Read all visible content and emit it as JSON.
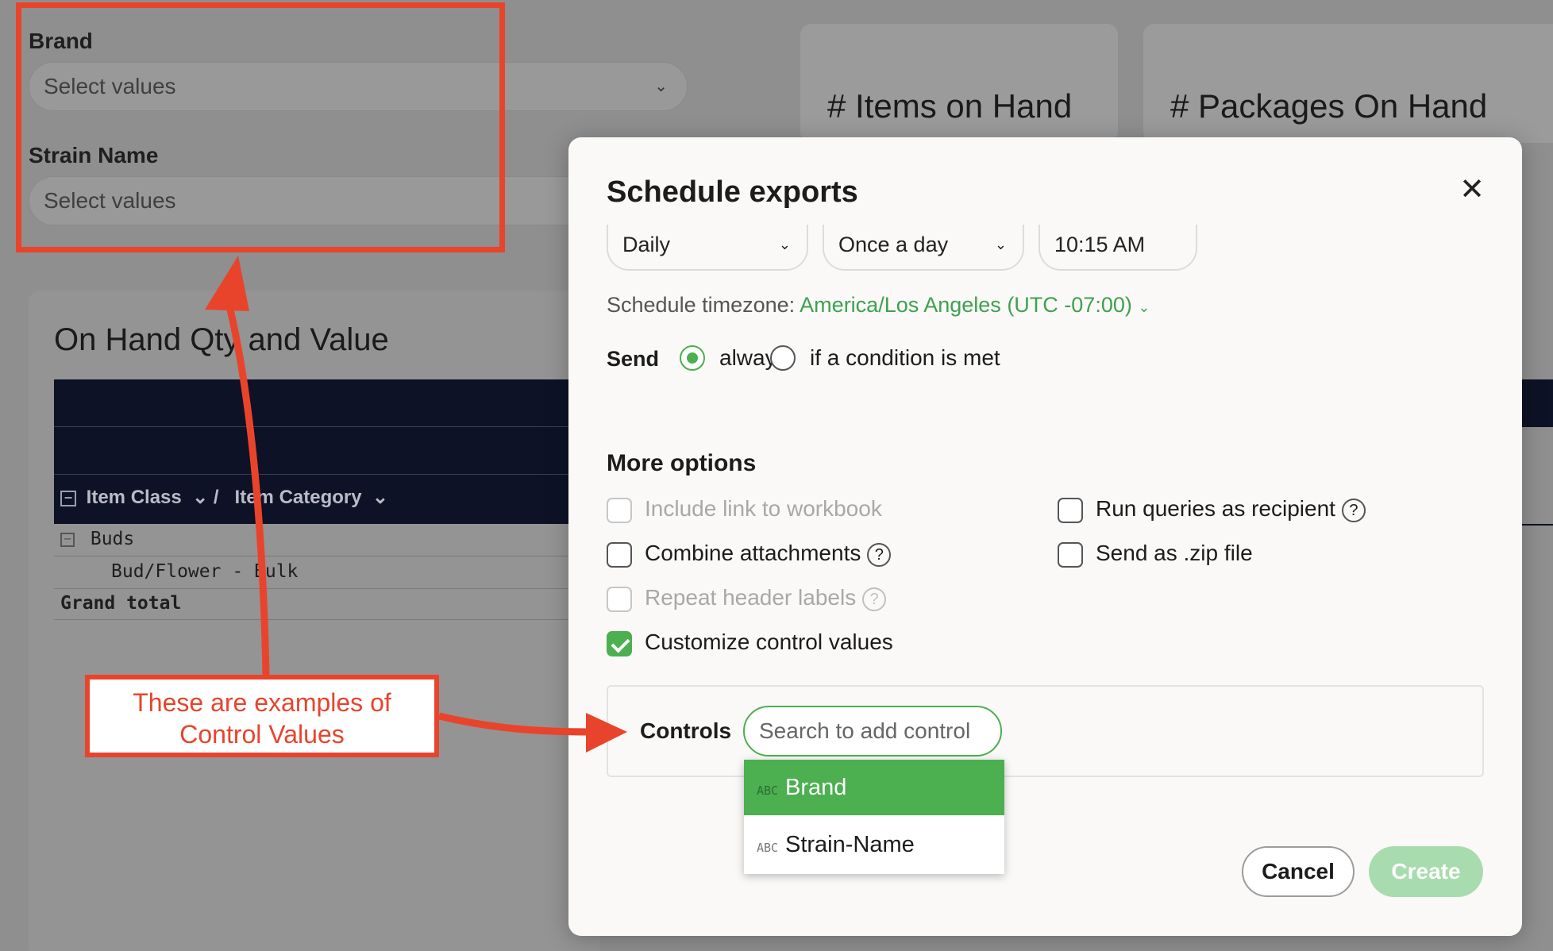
{
  "background": {
    "filters": [
      {
        "label": "Brand",
        "placeholder": "Select values"
      },
      {
        "label": "Strain Name",
        "placeholder": "Select values"
      }
    ],
    "cards": [
      "# Items on Hand",
      "# Packages On Hand"
    ],
    "panel_title": "On Hand Qty and Value",
    "table": {
      "col1": "Item Class",
      "separator": "/",
      "col2": "Item Category",
      "rows": [
        "Buds",
        "Bud/Flower - Bulk",
        "Grand total"
      ]
    }
  },
  "modal": {
    "title": "Schedule exports",
    "frequency": "Daily",
    "repeat": "Once a day",
    "time": "10:15 AM",
    "timezone_label": "Schedule timezone:",
    "timezone_value": "America/Los Angeles (UTC -07:00)",
    "send_label": "Send",
    "send_options": [
      {
        "label": "always",
        "selected": true
      },
      {
        "label": "if a condition is met",
        "selected": false
      }
    ],
    "more_options_title": "More options",
    "options": [
      {
        "label": "Include link to workbook",
        "checked": false,
        "disabled": true
      },
      {
        "label": "Combine attachments",
        "checked": false,
        "disabled": false,
        "help": true
      },
      {
        "label": "Repeat header labels",
        "checked": false,
        "disabled": true,
        "help": true
      },
      {
        "label": "Customize control values",
        "checked": true,
        "disabled": false
      },
      {
        "label": "Run queries as recipient",
        "checked": false,
        "disabled": false,
        "help": true
      },
      {
        "label": "Send as .zip file",
        "checked": false,
        "disabled": false
      }
    ],
    "help_glyph": "?",
    "controls_label": "Controls",
    "search_placeholder": "Search to add control",
    "dropdown_items": [
      {
        "type_badge": "ABC",
        "label": "Brand",
        "active": true
      },
      {
        "type_badge": "ABC",
        "label": "Strain-Name",
        "active": false
      }
    ],
    "cancel_label": "Cancel",
    "create_label": "Create",
    "accent_color": "#4caf50"
  },
  "annotation": {
    "callout_line1": "These are examples of",
    "callout_line2": "Control Values",
    "color": "#e8442c"
  }
}
